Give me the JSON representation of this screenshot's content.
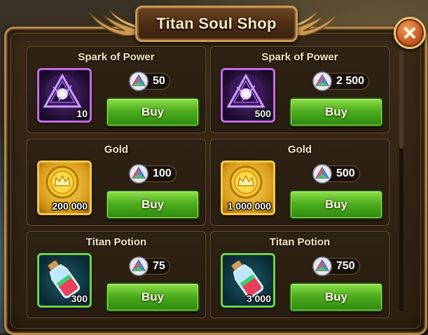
{
  "header": {
    "title": "Titan Soul Shop"
  },
  "colors": {
    "buy_button": "#4fae1e",
    "frame_gold": "#c99a55",
    "close_button": "#c75a22"
  },
  "items": [
    {
      "name": "Spark of Power",
      "icon": "spark-of-power-icon",
      "quantity": "10",
      "price": "50",
      "buy_label": "Buy"
    },
    {
      "name": "Spark of Power",
      "icon": "spark-of-power-icon",
      "quantity": "500",
      "price": "2 500",
      "buy_label": "Buy"
    },
    {
      "name": "Gold",
      "icon": "gold-coin-icon",
      "quantity": "200 000",
      "price": "100",
      "buy_label": "Buy"
    },
    {
      "name": "Gold",
      "icon": "gold-coin-icon",
      "quantity": "1 000 000",
      "price": "500",
      "buy_label": "Buy"
    },
    {
      "name": "Titan Potion",
      "icon": "titan-potion-icon",
      "quantity": "300",
      "price": "75",
      "buy_label": "Buy"
    },
    {
      "name": "Titan Potion",
      "icon": "titan-potion-icon",
      "quantity": "3 000",
      "price": "750",
      "buy_label": "Buy"
    }
  ],
  "currency_icon": "titan-soul-icon",
  "close_icon": "close-icon"
}
